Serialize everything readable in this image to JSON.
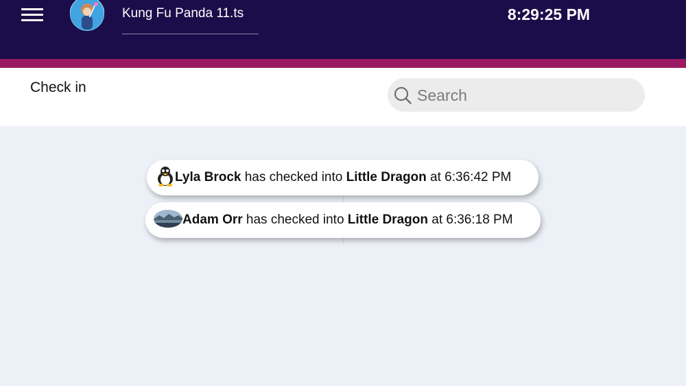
{
  "header": {
    "document_title": "Kung Fu Panda 11.ts",
    "clock": "8:29:25 PM"
  },
  "page": {
    "title": "Check in"
  },
  "search": {
    "placeholder": "Search",
    "value": ""
  },
  "checkins": [
    {
      "name": "Lyla Brock",
      "middle": " has checked into ",
      "place": "Little Dragon",
      "time_text": " at 6:36:42 PM",
      "avatar_icon": "penguin-icon"
    },
    {
      "name": "Adam Orr",
      "middle": " has checked into ",
      "place": "Little Dragon",
      "time_text": " at 6:36:18 PM",
      "avatar_icon": "landscape-photo-icon"
    }
  ],
  "colors": {
    "topbar": "#1b0d4a",
    "accent": "#9a1b63",
    "background": "#ecf0f7"
  }
}
